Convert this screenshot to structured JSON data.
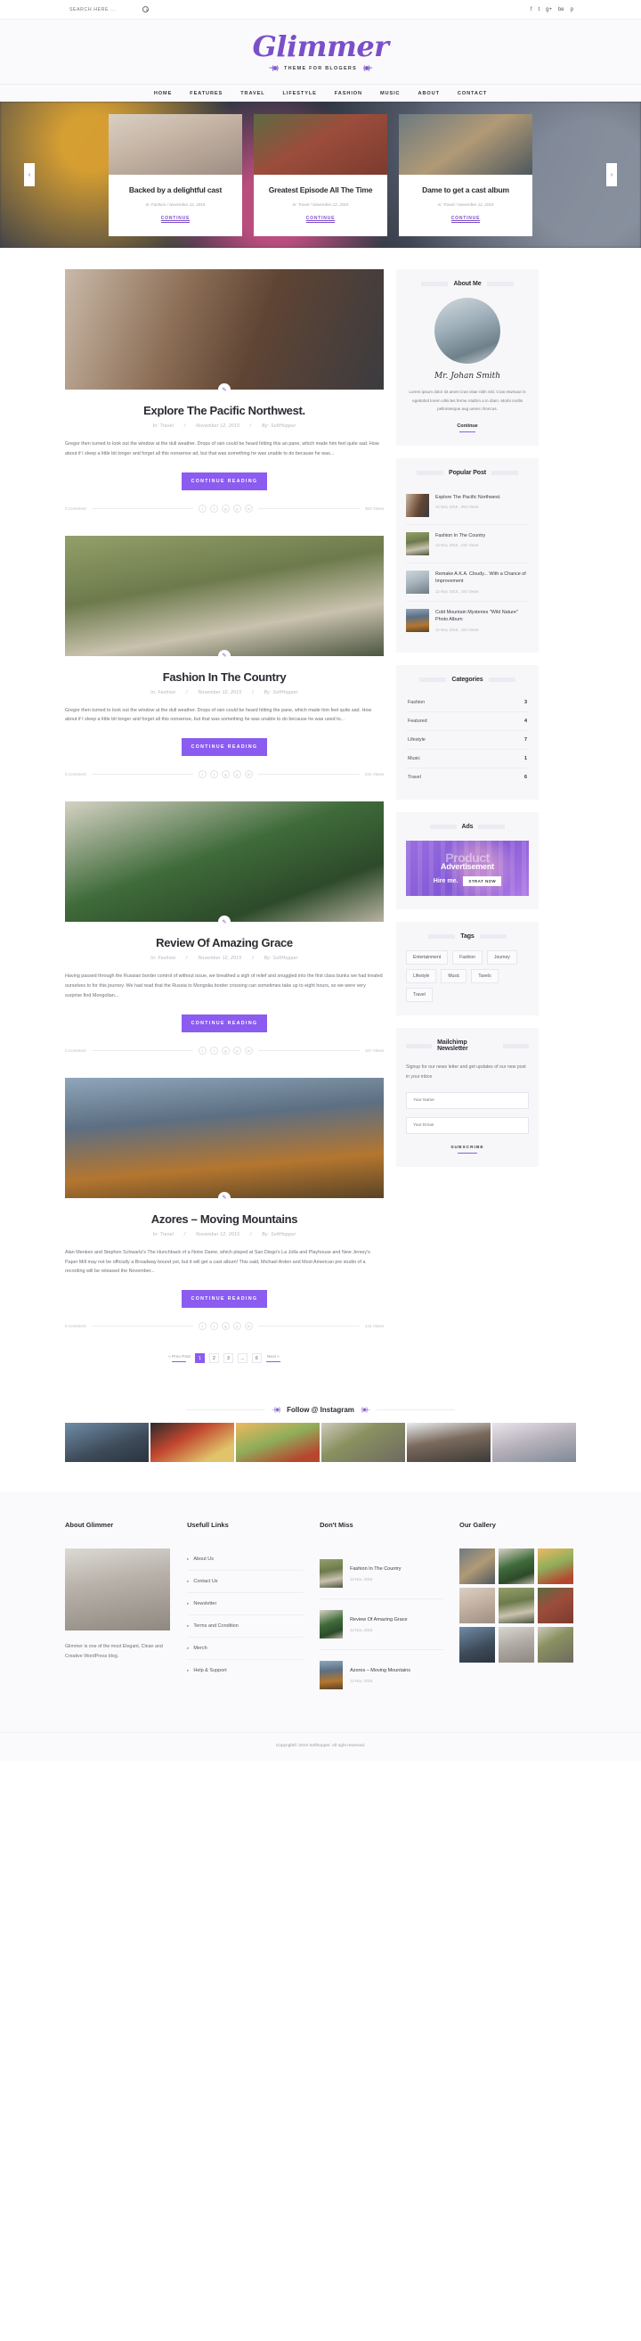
{
  "topbar": {
    "search_placeholder": "SEARCH HERE ...",
    "search_value": "",
    "social": [
      "f",
      "t",
      "g+",
      "be",
      "p"
    ]
  },
  "brand": {
    "name": "Glimmer",
    "tagline": "THEME FOR BLOGERS",
    "ornament_left": "···{◉}",
    "ornament_right": "{◉}···"
  },
  "nav": {
    "items": [
      "HOME",
      "FEATURES",
      "TRAVEL",
      "LIFESTYLE",
      "FASHION",
      "MUSIC",
      "ABOUT",
      "CONTACT"
    ]
  },
  "slider": {
    "prev": "‹",
    "next": "›",
    "cards": [
      {
        "title": "Backed by a delightful cast",
        "category": "In: Fashion",
        "date": "November 12, 2015",
        "cta": "CONTINUE"
      },
      {
        "title": "Greatest Episode All The Time",
        "category": "In: Travel",
        "date": "November 12, 2015",
        "cta": "CONTINUE"
      },
      {
        "title": "Dame to get a cast album",
        "category": "In: Travel",
        "date": "November 12, 2015",
        "cta": "CONTINUE"
      }
    ]
  },
  "posts": [
    {
      "title": "Explore The Pacific Northwest.",
      "category": "In: Travel",
      "date": "November 12, 2015",
      "author": "By: SoftHopper",
      "excerpt": "Gregor then turned to look out the window at the dull weather. Drops of rain could be heard hitting this an pane, which made him feel quite sad. How about if I sleep a little bit longer and forget all this nonsense ad, but that was something he was unable to do because he was...",
      "cta": "CONTINUE READING",
      "comments": "0 Comment",
      "views": "353 Views"
    },
    {
      "title": "Fashion In The Country",
      "category": "In: Fashion",
      "date": "November 12, 2015",
      "author": "By: SoftHopper",
      "excerpt": "Gregor then turned to look out the window at the dull weather. Drops of rain could be heard hitting the pane, which made him feel quite sad. How about if I sleep a little bit longer and forget all this nonsense, but that was something he was unable to do because he was used to...",
      "cta": "CONTINUE READING",
      "comments": "0 Comment",
      "views": "231 Views"
    },
    {
      "title": "Review Of Amazing Grace",
      "category": "In: Fashion",
      "date": "November 12, 2015",
      "author": "By: SoftHopper",
      "excerpt": "Having passed through the Russian border control of without issue, we breathed a sigh of relief and snuggled into the first class bunks we had treated ourselves to for this journey. We had read that the Russia to Mongolia border crossing can sometimes take up to eight hours, so we were very surprise find Mongolian...",
      "cta": "CONTINUE READING",
      "comments": "0 Comment",
      "views": "167 Views"
    },
    {
      "title": "Azores – Moving Mountains",
      "category": "In: Travel",
      "date": "November 12, 2015",
      "author": "By: SoftHopper",
      "excerpt": "Alan Menken and Stephen Schwartz's The Hunchback of a Notre Dame, which played at San Diego's La Jolla and Playhouse and New Jersey's Paper Mill may not be officially a Broadway bound yet, but it will get a cast album! This said, Michael Arden and Most American pre studio of a recording will be released  the  November...",
      "cta": "CONTINUE READING",
      "comments": "0 Comment",
      "views": "144 Views"
    }
  ],
  "share_icons": [
    "f",
    "t",
    "g",
    "p",
    "in"
  ],
  "sidebar": {
    "about": {
      "title": "About Me",
      "name": "Mr. Johan Smith",
      "text": "Lorem ipsum dolor sit amet Cras vitae nibh nisl. Cras etwmaur is egettobol lorem ultricles ferme ntutbm a in diam. Morbi mollis pellontesque aug uenec rhoncus.",
      "continue": "Continue"
    },
    "popular": {
      "title": "Popular Post",
      "items": [
        {
          "title": "Explore The Pacific Northwest.",
          "meta": "12 Nov, 2015 ,  353 Views"
        },
        {
          "title": "Fashion In The Country",
          "meta": "12 Nov, 2015 ,  231 Views"
        },
        {
          "title": "Remake A.K.A. Cloudy... With a Chance of Improvement",
          "meta": "12 Nov, 2015 ,  191 Views"
        },
        {
          "title": "Cold Mountain Mysteries \"Wild Nature\" Photo Album",
          "meta": "12 Nov, 2015 ,  184 Views"
        }
      ]
    },
    "categories": {
      "title": "Categories",
      "items": [
        {
          "name": "Fashion",
          "count": "3"
        },
        {
          "name": "Featured",
          "count": "4"
        },
        {
          "name": "Lifestyle",
          "count": "7"
        },
        {
          "name": "Music",
          "count": "1"
        },
        {
          "name": "Travel",
          "count": "6"
        }
      ]
    },
    "ads": {
      "title": "Ads",
      "line1": "Product",
      "line2": "Advertisement",
      "hire": "Hire me.",
      "button": "STRAT NOW"
    },
    "tags": {
      "title": "Tags",
      "items": [
        "Entertainment",
        "Fashion",
        "Journey",
        "Lifestyle",
        "Music",
        "Tavels",
        "Travel"
      ]
    },
    "newsletter": {
      "title": "Mailchimp Newsletter",
      "text": "Signup for our news letter and get updates of our new post in your inbox",
      "name_placeholder": "Your Name",
      "email_placeholder": "Your Email",
      "subscribe": "SUBSCRIBE"
    }
  },
  "pagination": {
    "prev": "«  Prev Post",
    "next": "Next  »",
    "pages": [
      "1",
      "2",
      "3",
      "...",
      "6"
    ],
    "active": "1"
  },
  "instagram": {
    "title": "Follow @ Instagram",
    "ornament_left": "···{◉}",
    "ornament_right": "{◉}···"
  },
  "footer": {
    "about": {
      "title": "About Glimmer",
      "text": "Glimmer is one of the most Elegant, Clean and Creative WordPress blog."
    },
    "links": {
      "title": "Usefull Links",
      "items": [
        "About Us",
        "Contact Us",
        "Newsletter",
        "Terms and Condition",
        "Merch",
        "Help & Support"
      ]
    },
    "dontmiss": {
      "title": "Don't Miss",
      "items": [
        {
          "title": "Fashion In The Country",
          "date": "12 Nov, 2015"
        },
        {
          "title": "Review Of Amazing Grace",
          "date": "12 Nov, 2015"
        },
        {
          "title": "Azores – Moving Mountains",
          "date": "12 Nov, 2015"
        }
      ]
    },
    "gallery": {
      "title": "Our Gallery"
    },
    "copyright": "Copyright© 2019 Softhopper. All right reserved."
  }
}
